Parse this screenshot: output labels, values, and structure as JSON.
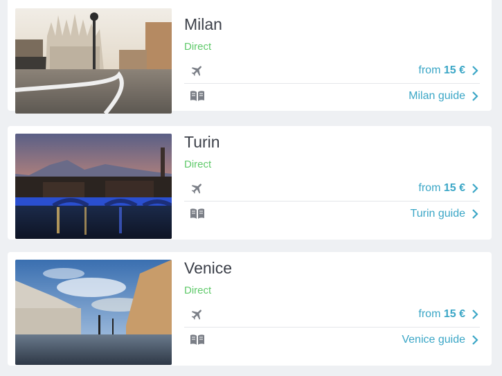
{
  "destinations": [
    {
      "city": "Milan",
      "direct": "Direct",
      "price_prefix": "from",
      "price_value": "15 €",
      "guide_label": "Milan guide",
      "photo": "milan-cathedral-photo"
    },
    {
      "city": "Turin",
      "direct": "Direct",
      "price_prefix": "from",
      "price_value": "15 €",
      "guide_label": "Turin guide",
      "photo": "turin-bridge-night-photo"
    },
    {
      "city": "Venice",
      "direct": "Direct",
      "price_prefix": "from",
      "price_value": "15 €",
      "guide_label": "Venice guide",
      "photo": "venice-san-marco-photo"
    }
  ],
  "colors": {
    "accent": "#3aa6c6",
    "direct_green": "#5fc96a",
    "title": "#3b3f48",
    "icon_gray": "#7a7e86"
  },
  "icons": {
    "flight": "plane-icon",
    "guide": "book-icon",
    "arrow": "chevron-right-icon"
  }
}
